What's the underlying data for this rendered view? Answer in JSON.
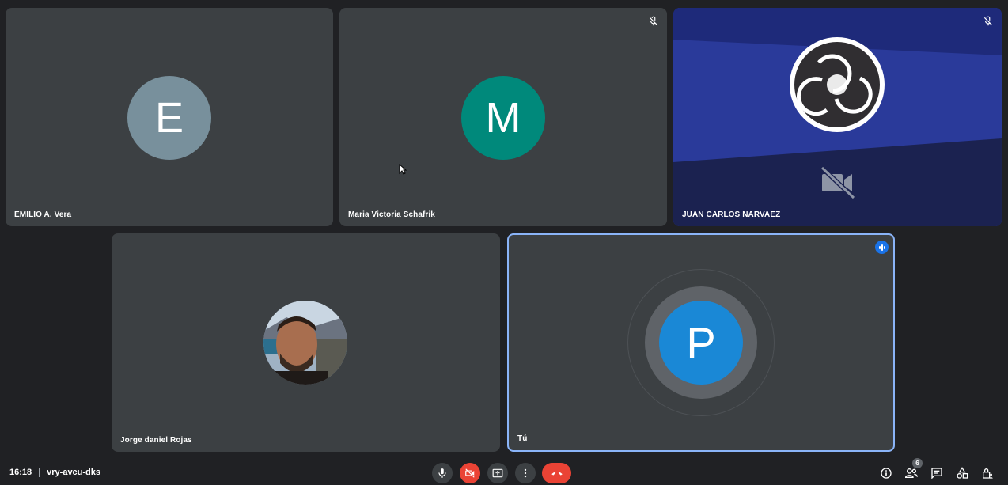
{
  "participants": [
    {
      "name": "EMILIO A. Vera",
      "initial": "E",
      "avatar_color": "#78909c",
      "muted": false
    },
    {
      "name": "Maria Victoria Schafrik",
      "initial": "M",
      "avatar_color": "#00897b",
      "muted": true
    },
    {
      "name": "JUAN CARLOS NARVAEZ",
      "muted": true,
      "camera_off": true,
      "avatar_icon": "obs-logo-icon"
    },
    {
      "name": "Jorge daniel Rojas",
      "avatar_icon": "profile-photo"
    },
    {
      "name": "Tú",
      "initial": "P",
      "avatar_color": "#1a88d6",
      "speaking": true
    }
  ],
  "bottom_bar": {
    "time": "16:18",
    "meeting_code": "vry-avcu-dks",
    "participants_count": "6"
  },
  "colors": {
    "background": "#202124",
    "tile": "#3c4043",
    "active_border": "#8ab4f8",
    "danger": "#ea4335"
  }
}
